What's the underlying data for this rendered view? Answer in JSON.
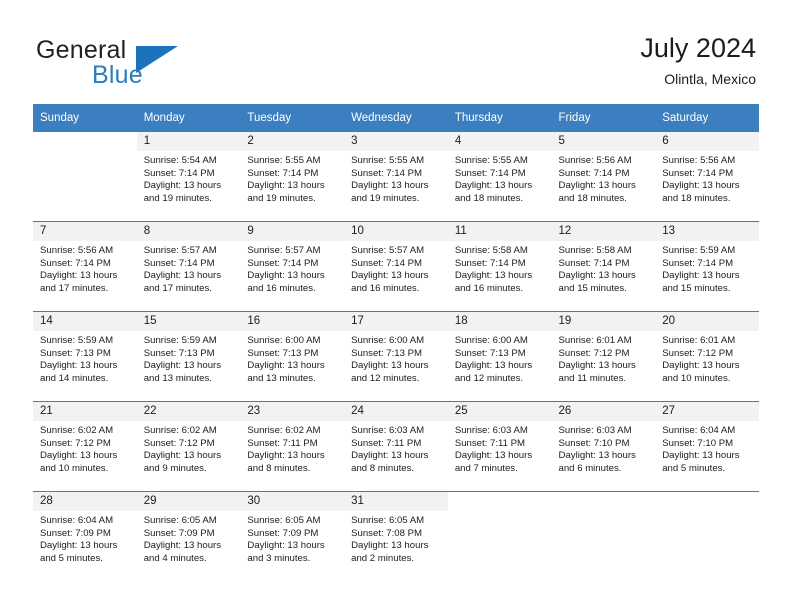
{
  "brand": {
    "word1": "General",
    "word2": "Blue",
    "mark": "triangle-logo",
    "accent_color": "#1b74bb"
  },
  "header": {
    "title": "July 2024",
    "subtitle": "Olintla, Mexico"
  },
  "theme": {
    "header_row_bg": "#3c7fc1",
    "daynum_bg": "#f2f2f2",
    "text": "#1c1c1c"
  },
  "labels": {
    "sunrise_prefix": "Sunrise:",
    "sunset_prefix": "Sunset:",
    "daylight_prefix": "Daylight:"
  },
  "weekdays": [
    "Sunday",
    "Monday",
    "Tuesday",
    "Wednesday",
    "Thursday",
    "Friday",
    "Saturday"
  ],
  "weeks": [
    [
      {
        "day": "",
        "sunrise": "",
        "sunset": "",
        "daylight1": "",
        "daylight2": "",
        "blank": true
      },
      {
        "day": "1",
        "sunrise": "Sunrise: 5:54 AM",
        "sunset": "Sunset: 7:14 PM",
        "daylight1": "Daylight: 13 hours",
        "daylight2": "and 19 minutes."
      },
      {
        "day": "2",
        "sunrise": "Sunrise: 5:55 AM",
        "sunset": "Sunset: 7:14 PM",
        "daylight1": "Daylight: 13 hours",
        "daylight2": "and 19 minutes."
      },
      {
        "day": "3",
        "sunrise": "Sunrise: 5:55 AM",
        "sunset": "Sunset: 7:14 PM",
        "daylight1": "Daylight: 13 hours",
        "daylight2": "and 19 minutes."
      },
      {
        "day": "4",
        "sunrise": "Sunrise: 5:55 AM",
        "sunset": "Sunset: 7:14 PM",
        "daylight1": "Daylight: 13 hours",
        "daylight2": "and 18 minutes."
      },
      {
        "day": "5",
        "sunrise": "Sunrise: 5:56 AM",
        "sunset": "Sunset: 7:14 PM",
        "daylight1": "Daylight: 13 hours",
        "daylight2": "and 18 minutes."
      },
      {
        "day": "6",
        "sunrise": "Sunrise: 5:56 AM",
        "sunset": "Sunset: 7:14 PM",
        "daylight1": "Daylight: 13 hours",
        "daylight2": "and 18 minutes."
      }
    ],
    [
      {
        "day": "7",
        "sunrise": "Sunrise: 5:56 AM",
        "sunset": "Sunset: 7:14 PM",
        "daylight1": "Daylight: 13 hours",
        "daylight2": "and 17 minutes."
      },
      {
        "day": "8",
        "sunrise": "Sunrise: 5:57 AM",
        "sunset": "Sunset: 7:14 PM",
        "daylight1": "Daylight: 13 hours",
        "daylight2": "and 17 minutes."
      },
      {
        "day": "9",
        "sunrise": "Sunrise: 5:57 AM",
        "sunset": "Sunset: 7:14 PM",
        "daylight1": "Daylight: 13 hours",
        "daylight2": "and 16 minutes."
      },
      {
        "day": "10",
        "sunrise": "Sunrise: 5:57 AM",
        "sunset": "Sunset: 7:14 PM",
        "daylight1": "Daylight: 13 hours",
        "daylight2": "and 16 minutes."
      },
      {
        "day": "11",
        "sunrise": "Sunrise: 5:58 AM",
        "sunset": "Sunset: 7:14 PM",
        "daylight1": "Daylight: 13 hours",
        "daylight2": "and 16 minutes."
      },
      {
        "day": "12",
        "sunrise": "Sunrise: 5:58 AM",
        "sunset": "Sunset: 7:14 PM",
        "daylight1": "Daylight: 13 hours",
        "daylight2": "and 15 minutes."
      },
      {
        "day": "13",
        "sunrise": "Sunrise: 5:59 AM",
        "sunset": "Sunset: 7:14 PM",
        "daylight1": "Daylight: 13 hours",
        "daylight2": "and 15 minutes."
      }
    ],
    [
      {
        "day": "14",
        "sunrise": "Sunrise: 5:59 AM",
        "sunset": "Sunset: 7:13 PM",
        "daylight1": "Daylight: 13 hours",
        "daylight2": "and 14 minutes."
      },
      {
        "day": "15",
        "sunrise": "Sunrise: 5:59 AM",
        "sunset": "Sunset: 7:13 PM",
        "daylight1": "Daylight: 13 hours",
        "daylight2": "and 13 minutes."
      },
      {
        "day": "16",
        "sunrise": "Sunrise: 6:00 AM",
        "sunset": "Sunset: 7:13 PM",
        "daylight1": "Daylight: 13 hours",
        "daylight2": "and 13 minutes."
      },
      {
        "day": "17",
        "sunrise": "Sunrise: 6:00 AM",
        "sunset": "Sunset: 7:13 PM",
        "daylight1": "Daylight: 13 hours",
        "daylight2": "and 12 minutes."
      },
      {
        "day": "18",
        "sunrise": "Sunrise: 6:00 AM",
        "sunset": "Sunset: 7:13 PM",
        "daylight1": "Daylight: 13 hours",
        "daylight2": "and 12 minutes."
      },
      {
        "day": "19",
        "sunrise": "Sunrise: 6:01 AM",
        "sunset": "Sunset: 7:12 PM",
        "daylight1": "Daylight: 13 hours",
        "daylight2": "and 11 minutes."
      },
      {
        "day": "20",
        "sunrise": "Sunrise: 6:01 AM",
        "sunset": "Sunset: 7:12 PM",
        "daylight1": "Daylight: 13 hours",
        "daylight2": "and 10 minutes."
      }
    ],
    [
      {
        "day": "21",
        "sunrise": "Sunrise: 6:02 AM",
        "sunset": "Sunset: 7:12 PM",
        "daylight1": "Daylight: 13 hours",
        "daylight2": "and 10 minutes."
      },
      {
        "day": "22",
        "sunrise": "Sunrise: 6:02 AM",
        "sunset": "Sunset: 7:12 PM",
        "daylight1": "Daylight: 13 hours",
        "daylight2": "and 9 minutes."
      },
      {
        "day": "23",
        "sunrise": "Sunrise: 6:02 AM",
        "sunset": "Sunset: 7:11 PM",
        "daylight1": "Daylight: 13 hours",
        "daylight2": "and 8 minutes."
      },
      {
        "day": "24",
        "sunrise": "Sunrise: 6:03 AM",
        "sunset": "Sunset: 7:11 PM",
        "daylight1": "Daylight: 13 hours",
        "daylight2": "and 8 minutes."
      },
      {
        "day": "25",
        "sunrise": "Sunrise: 6:03 AM",
        "sunset": "Sunset: 7:11 PM",
        "daylight1": "Daylight: 13 hours",
        "daylight2": "and 7 minutes."
      },
      {
        "day": "26",
        "sunrise": "Sunrise: 6:03 AM",
        "sunset": "Sunset: 7:10 PM",
        "daylight1": "Daylight: 13 hours",
        "daylight2": "and 6 minutes."
      },
      {
        "day": "27",
        "sunrise": "Sunrise: 6:04 AM",
        "sunset": "Sunset: 7:10 PM",
        "daylight1": "Daylight: 13 hours",
        "daylight2": "and 5 minutes."
      }
    ],
    [
      {
        "day": "28",
        "sunrise": "Sunrise: 6:04 AM",
        "sunset": "Sunset: 7:09 PM",
        "daylight1": "Daylight: 13 hours",
        "daylight2": "and 5 minutes."
      },
      {
        "day": "29",
        "sunrise": "Sunrise: 6:05 AM",
        "sunset": "Sunset: 7:09 PM",
        "daylight1": "Daylight: 13 hours",
        "daylight2": "and 4 minutes."
      },
      {
        "day": "30",
        "sunrise": "Sunrise: 6:05 AM",
        "sunset": "Sunset: 7:09 PM",
        "daylight1": "Daylight: 13 hours",
        "daylight2": "and 3 minutes."
      },
      {
        "day": "31",
        "sunrise": "Sunrise: 6:05 AM",
        "sunset": "Sunset: 7:08 PM",
        "daylight1": "Daylight: 13 hours",
        "daylight2": "and 2 minutes."
      },
      {
        "day": "",
        "sunrise": "",
        "sunset": "",
        "daylight1": "",
        "daylight2": "",
        "blank": true
      },
      {
        "day": "",
        "sunrise": "",
        "sunset": "",
        "daylight1": "",
        "daylight2": "",
        "blank": true
      },
      {
        "day": "",
        "sunrise": "",
        "sunset": "",
        "daylight1": "",
        "daylight2": "",
        "blank": true
      }
    ]
  ]
}
